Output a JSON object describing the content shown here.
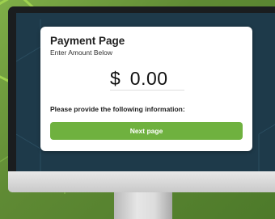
{
  "payment": {
    "title": "Payment Page",
    "subtitle": "Enter Amount Below",
    "currency_symbol": "$",
    "amount": "0.00",
    "info_label": "Please provide the following information:",
    "next_button": "Next page"
  },
  "colors": {
    "background_green": "#6e9a3c",
    "button_green": "#6fb13f",
    "screen_dark": "#1e3a4a",
    "bezel": "#1a1d1f",
    "card": "#ffffff"
  },
  "icons": {
    "background_pattern": "hexagon-outline-icon"
  }
}
